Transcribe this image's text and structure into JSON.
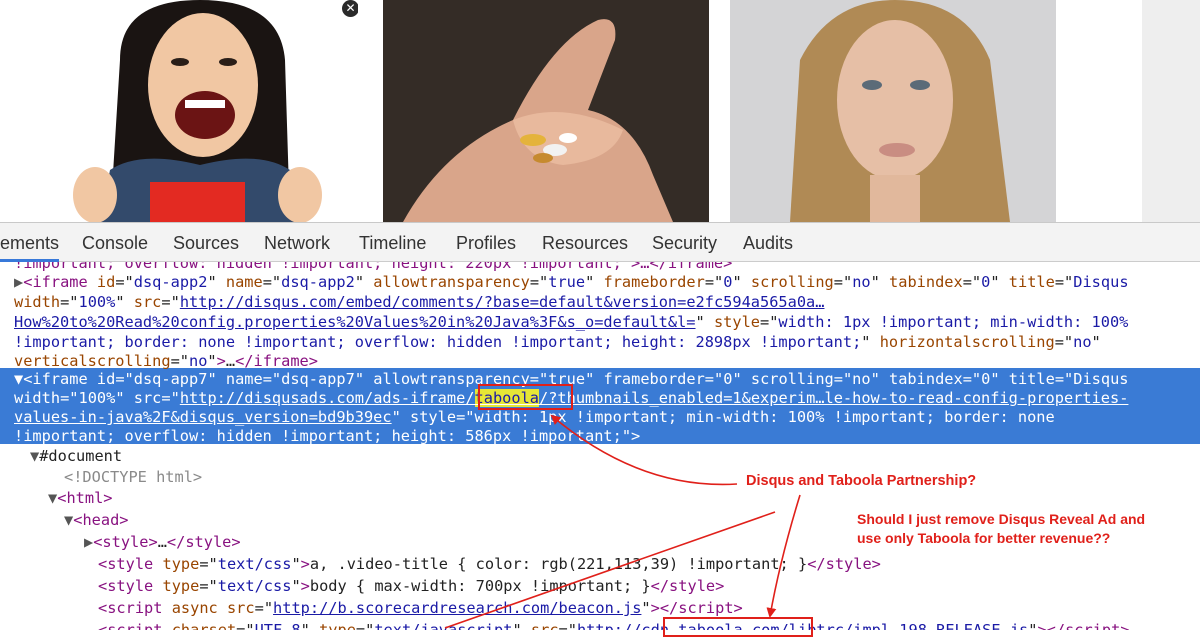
{
  "ad_thumbnails": {
    "close_symbol": "✕"
  },
  "devtools": {
    "tabs": [
      "ements",
      "Console",
      "Sources",
      "Network",
      "Timeline",
      "Profiles",
      "Resources",
      "Security",
      "Audits"
    ],
    "selected_tab": "ements"
  },
  "dom": {
    "line0": "!important; overflow: hidden !important; height: 220px !important;\">…</iframe>",
    "iframe1": {
      "tag": "iframe",
      "id": "dsq-app2",
      "name": "dsq-app2",
      "allowtransparency": "true",
      "frameborder": "0",
      "scrolling": "no",
      "tabindex": "0",
      "title": "Disqus",
      "width": "100%",
      "src_a": "http://disqus.com/embed/comments/?base=default&version=e2fc594a565a0a…",
      "src_b": "How%20to%20Read%20config.properties%20Values%20in%20Java%3F&s_o=default&l=",
      "style_a": "width: 1px !important; min-width: 100%",
      "style_b": "!important; border: none !important; overflow: hidden !important; height: 2898px !important;",
      "horizontalscrolling": "no",
      "verticalscrolling": "no",
      "ellipsis": "…"
    },
    "iframe2": {
      "id": "dsq-app7",
      "name": "dsq-app7",
      "allowtransparency": "true",
      "frameborder": "0",
      "scrolling": "no",
      "tabindex": "0",
      "title": "Disqus",
      "width": "100%",
      "src_pre": "http://disqusads.com/ads-iframe/",
      "src_hl": "taboola",
      "src_post": "/?thumbnails_enabled=1&experim…le-how-to-read-config-properties-",
      "src_b": "values-in-java%2F&disqus_version=bd9b39ec",
      "style_a": "width: 1px !important; min-width: 100% !important; border: none",
      "style_b": "!important; overflow: hidden !important; height: 586px !important;"
    },
    "document_label": "#document",
    "doctype": "<!DOCTYPE html>",
    "html_tag": "html",
    "head_tag": "head",
    "style_collapsed": "…",
    "style1": {
      "type": "text/css",
      "content": "a, .video-title { color: rgb(221,113,39) !important; }"
    },
    "style2": {
      "type": "text/css",
      "content": "body { max-width: 700px !important; }"
    },
    "script1": {
      "src": "http://b.scorecardresearch.com/beacon.js"
    },
    "script2": {
      "charset": "UTF-8",
      "type": "text/javascript",
      "src": "http://cdn.taboola.com/libtrc/impl.198-RELEASE.js"
    }
  },
  "annotations": {
    "partnership": "Disqus and Taboola Partnership?",
    "question_line1": "Should I just remove Disqus Reveal Ad and",
    "question_line2": "use only Taboola for better revenue??"
  },
  "colors": {
    "selection": "#3a7bd5",
    "annotation_red": "#e0201a",
    "highlight": "#e6e636",
    "tag": "#881280",
    "attr_name": "#994500",
    "attr_value": "#1a1aa6"
  }
}
